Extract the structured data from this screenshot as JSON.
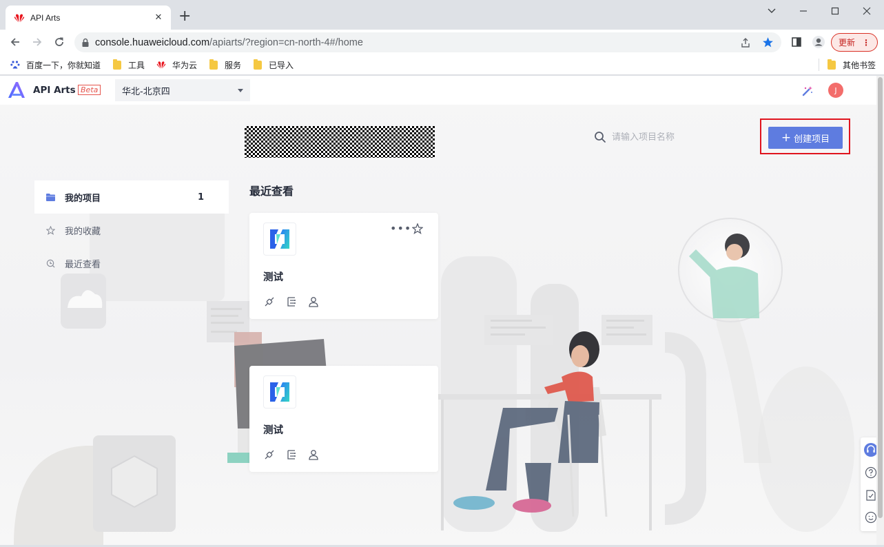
{
  "browser": {
    "tab_title": "API Arts",
    "url_host": "console.huaweicloud.com",
    "url_path": "/apiarts/?region=cn-north-4#/home",
    "update_label": "更新",
    "bookmarks": [
      "百度一下，你就知道",
      "工具",
      "华为云",
      "服务",
      "已导入"
    ],
    "other_bookmarks": "其他书签"
  },
  "header": {
    "brand": "API Arts",
    "beta": "Beta",
    "region": "华北-北京四",
    "avatar": "J"
  },
  "search": {
    "placeholder": "请输入项目名称"
  },
  "create_button": "创建项目",
  "sidebar": {
    "items": [
      {
        "label": "我的项目",
        "count": "1",
        "icon": "folder-icon"
      },
      {
        "label": "我的收藏",
        "icon": "star-icon"
      },
      {
        "label": "最近查看",
        "icon": "clock-icon"
      }
    ]
  },
  "recent": {
    "title": "最近查看",
    "cards": [
      {
        "name": "测试"
      },
      {
        "name": "测试"
      }
    ]
  },
  "colors": {
    "accent": "#5e7ce0",
    "highlight": "#e0141e",
    "avatar": "#f36d6b"
  }
}
